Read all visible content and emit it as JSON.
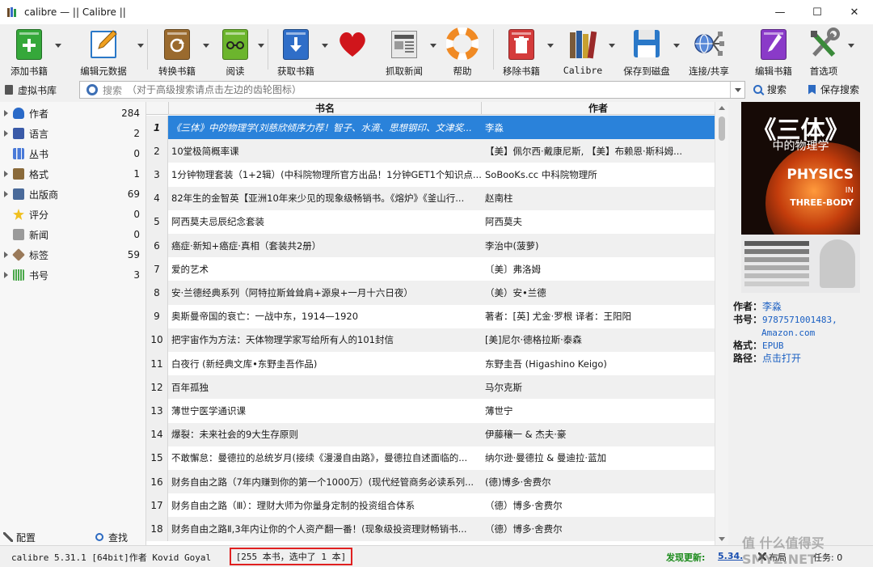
{
  "window": {
    "title": "calibre — || Calibre ||",
    "controls": {
      "minimize": "—",
      "maximize": "☐",
      "close": "✕"
    }
  },
  "toolbar": {
    "items": [
      {
        "label": "添加书籍",
        "icon": "add-book-icon",
        "color": "#35a83a"
      },
      {
        "label": "编辑元数据",
        "icon": "edit-metadata-icon",
        "color": "#e8a224"
      },
      {
        "label": "转换书籍",
        "icon": "convert-book-icon",
        "color": "#9a6a2e"
      },
      {
        "label": "阅读",
        "icon": "read-book-icon",
        "color": "#6cb52d"
      },
      {
        "label": "获取书籍",
        "icon": "get-books-icon",
        "color": "#2f6ec8"
      },
      {
        "label": "",
        "icon": "heart-icon",
        "color": "#d0151b"
      },
      {
        "label": "抓取新闻",
        "icon": "fetch-news-icon",
        "color": "#8a8a8a"
      },
      {
        "label": "帮助",
        "icon": "help-lifebuoy-icon",
        "color": "#f08a24"
      },
      {
        "label": "移除书籍",
        "icon": "remove-book-icon",
        "color": "#d43b3b"
      },
      {
        "label": "Calibre",
        "icon": "library-books-icon",
        "color": "#7a5a3a"
      },
      {
        "label": "保存到磁盘",
        "icon": "save-to-disk-icon",
        "color": "#2a78c8"
      },
      {
        "label": "连接/共享",
        "icon": "connect-share-icon",
        "color": "#3a5a9a"
      },
      {
        "label": "编辑书籍",
        "icon": "edit-book-icon",
        "color": "#8a3ac8"
      },
      {
        "label": "首选项",
        "icon": "preferences-tools-icon",
        "color": "#3a8a3a"
      }
    ]
  },
  "search": {
    "virtual_library": "虚拟书库",
    "placeholder_label": "搜索",
    "placeholder": "（对于高级搜索请点击左边的齿轮图标）",
    "search_button": "搜索",
    "save_search_button": "保存搜索"
  },
  "categories": [
    {
      "label": "作者",
      "count": "284",
      "expandable": true,
      "icon_color": "#2a6ac8"
    },
    {
      "label": "语言",
      "count": "2",
      "expandable": true,
      "icon_color": "#3a5aa8"
    },
    {
      "label": "丛书",
      "count": "0",
      "expandable": false,
      "icon_color": "#4a7ad8"
    },
    {
      "label": "格式",
      "count": "1",
      "expandable": true,
      "icon_color": "#8a6a3a"
    },
    {
      "label": "出版商",
      "count": "69",
      "expandable": true,
      "icon_color": "#4a6a9a"
    },
    {
      "label": "评分",
      "count": "0",
      "expandable": false,
      "icon_color": "#f0c020"
    },
    {
      "label": "新闻",
      "count": "0",
      "expandable": false,
      "icon_color": "#7a7a7a"
    },
    {
      "label": "标签",
      "count": "59",
      "expandable": true,
      "icon_color": "#9a7a5a"
    },
    {
      "label": "书号",
      "count": "3",
      "expandable": true,
      "icon_color": "#4aa84a"
    }
  ],
  "left_bottom": {
    "configure": "配置",
    "find": "查找"
  },
  "table": {
    "columns": [
      "书名",
      "作者"
    ],
    "rows": [
      {
        "num": "1",
        "title": "《三体》中的物理学(刘慈欣倾序力荐！智子、水滴、思想钢印、文津奖...",
        "author": "李淼"
      },
      {
        "num": "2",
        "title": "10堂极简概率课",
        "author": "【美】佩尔西·戴康尼斯, 【美】布赖恩·斯科姆..."
      },
      {
        "num": "3",
        "title": "1分钟物理套装（1+2辑）(中科院物理所官方出品！1分钟GET1个知识点...",
        "author": "SoBooKs.cc 中科院物理所"
      },
      {
        "num": "4",
        "title": "82年生的金智英【亚洲10年来少见的现象级畅销书。《熔炉》《釜山行...",
        "author": "赵南柱"
      },
      {
        "num": "5",
        "title": "阿西莫夫忌辰纪念套装",
        "author": "阿西莫夫"
      },
      {
        "num": "6",
        "title": "癌症·新知+癌症·真相（套装共2册）",
        "author": "李治中(菠萝)"
      },
      {
        "num": "7",
        "title": "爱的艺术",
        "author": "〔美〕弗洛姆"
      },
      {
        "num": "8",
        "title": "安·兰德经典系列（阿特拉斯耸耸肩+源泉+一月十六日夜）",
        "author": "（美）安•兰德"
      },
      {
        "num": "9",
        "title": "奥斯曼帝国的衰亡：一战中东，1914—1920",
        "author": "著者：[英] 尤金·罗根 译者：王阳阳"
      },
      {
        "num": "10",
        "title": "把宇宙作为方法：天体物理学家写给所有人的101封信",
        "author": "[美]尼尔·德格拉斯·泰森"
      },
      {
        "num": "11",
        "title": "白夜行 (新经典文库•东野圭吾作品)",
        "author": "东野圭吾 (Higashino Keigo)"
      },
      {
        "num": "12",
        "title": "百年孤独",
        "author": "马尔克斯"
      },
      {
        "num": "13",
        "title": "薄世宁医学通识课",
        "author": "薄世宁"
      },
      {
        "num": "14",
        "title": "爆裂：未来社会的9大生存原则",
        "author": "伊藤穰一 & 杰夫·豪"
      },
      {
        "num": "15",
        "title": "不敢懈怠：曼德拉的总统岁月(接续《漫漫自由路》，曼德拉自述面临的...",
        "author": "纳尔逊·曼德拉 & 曼迪拉·蓝加"
      },
      {
        "num": "16",
        "title": "财务自由之路（7年内赚到你的第一个1000万）(现代经管商务必读系列...",
        "author": "(德)博多·舍费尔"
      },
      {
        "num": "17",
        "title": "财务自由之路（Ⅲ）：理财大师为你量身定制的投资组合体系",
        "author": "（德）博多·舍费尔"
      },
      {
        "num": "18",
        "title": "财务自由之路Ⅱ,3年内让你的个人资产翻一番！(现象级投资理财畅销书...",
        "author": "（德）博多·舍费尔"
      }
    ]
  },
  "cover": {
    "title_big": "《三体》",
    "title_sub": "中的物理学",
    "physics": "PHYSICS",
    "in": "IN",
    "three_body": "THREE-BODY"
  },
  "details": {
    "author_label": "作者：",
    "author": "李淼",
    "isbn_label": "书号：",
    "isbn": "9787571001483,",
    "isbn_link2": "Amazon.com",
    "format_label": "格式：",
    "format": "EPUB",
    "path_label": "路径：",
    "path": "点击打开"
  },
  "status": {
    "version": "calibre 5.31.1 [64bit]作者 Kovid Goyal",
    "count": "[255 本书，选中了 1 本]",
    "update_label": "发现更新:",
    "update_version": "5.34.",
    "layout": "布局",
    "jobs": "任务: 0"
  },
  "watermark": "值 什么值得买 SMYZ.NET"
}
